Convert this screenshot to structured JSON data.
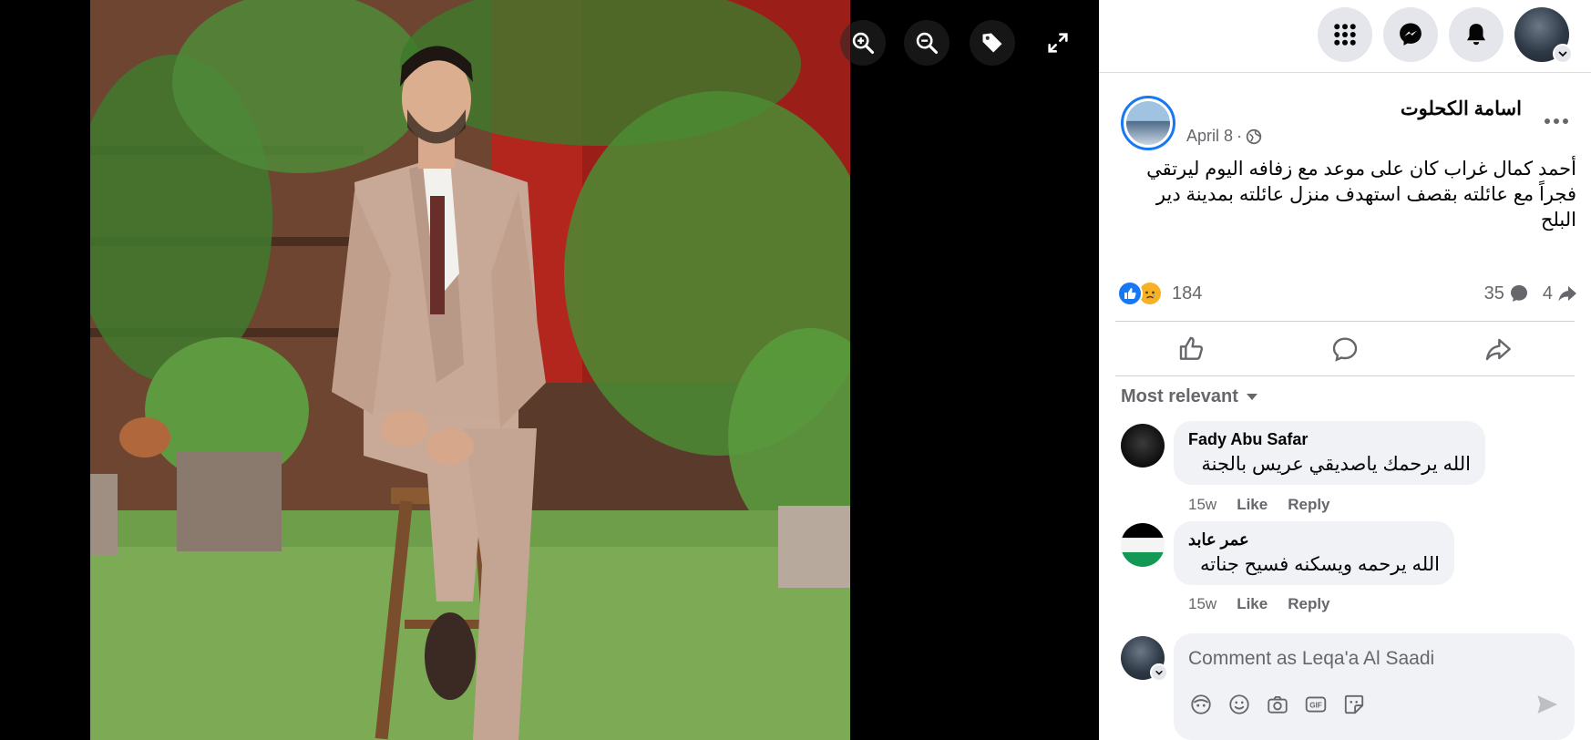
{
  "viewer": {
    "controls": [
      "zoom-in",
      "zoom-out",
      "tag",
      "fullscreen"
    ]
  },
  "topbar": {
    "icons": [
      "apps-menu-icon",
      "messenger-icon",
      "notifications-icon",
      "account-icon"
    ]
  },
  "post": {
    "author": "اسامة الكحلوت",
    "date": "April 8",
    "separator": "·",
    "privacy_icon": "globe-icon",
    "text": "أحمد كمال غراب كان على موعد مع زفافه اليوم ليرتقي فجراً مع عائلته بقصف استهدف منزل عائلته بمدينة دير البلح",
    "reactions": {
      "types": [
        "like",
        "sad"
      ],
      "count": "184"
    },
    "comments_count": "35",
    "shares_count": "4"
  },
  "sort": {
    "label": "Most relevant"
  },
  "comments": [
    {
      "author": "Fady Abu Safar",
      "text": "الله يرحمك ياصديقي عريس بالجنة",
      "time": "15w",
      "like_label": "Like",
      "reply_label": "Reply"
    },
    {
      "author": "عمر عابد",
      "text": "الله يرحمه ويسكنه فسيح جناته",
      "time": "15w",
      "like_label": "Like",
      "reply_label": "Reply"
    }
  ],
  "composer": {
    "placeholder": "Comment as Leqa'a Al Saadi",
    "tools": [
      "avatar-sticker-icon",
      "emoji-icon",
      "camera-icon",
      "gif-icon",
      "sticker-icon"
    ]
  },
  "colors": {
    "accent": "#1877f2",
    "secondary_text": "#65676b",
    "bubble_bg": "#f0f2f5",
    "button_bg": "#e4e6eb"
  }
}
